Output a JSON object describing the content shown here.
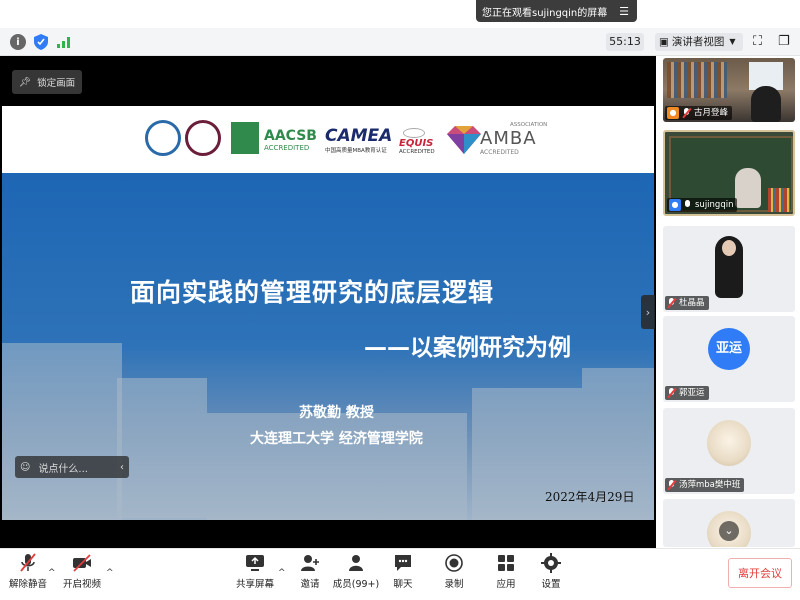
{
  "banner": {
    "text": "您正在观看sujingqin的屏幕",
    "menu_icon": "menu-icon"
  },
  "toolbar": {
    "timer": "55:13",
    "presenter_view": "演讲者视图",
    "icons": [
      "info-icon",
      "shield-icon",
      "signal-icon",
      "fullscreen-icon",
      "window-icon"
    ]
  },
  "stage": {
    "pin_label": "锁定画面",
    "chat_placeholder": "说点什么..."
  },
  "slide": {
    "logos": {
      "aacsb": "AACSB",
      "aacsb_sub": "ACCREDITED",
      "camea": "CAMEA",
      "camea_sub": "中国高质量MBA教育认证",
      "equis": "EQUIS",
      "equis_sub": "ACCREDITED",
      "amba": "AMBA",
      "amba_top": "ASSOCIATION",
      "amba_sub": "ACCREDITED"
    },
    "title": "面向实践的管理研究的底层逻辑",
    "subtitle": "——以案例研究为例",
    "speaker": "苏敬勤 教授",
    "school": "大连理工大学 经济管理学院",
    "date": "2022年4月29日"
  },
  "participants": [
    {
      "name": "古月登峰",
      "mic": "muted"
    },
    {
      "name": "sujingqin",
      "mic": "on"
    },
    {
      "name": "杜晶晶",
      "mic": "muted"
    },
    {
      "name": "郭亚运",
      "mic": "muted",
      "avatar_text": "亚运"
    },
    {
      "name": "汤萍mba樊中班",
      "mic": "muted"
    },
    {
      "name": "",
      "mic": ""
    }
  ],
  "bottombar": {
    "unmute": "解除静音",
    "start_video": "开启视频",
    "share_screen": "共享屏幕",
    "invite": "邀请",
    "members": "成员(99+)",
    "chat": "聊天",
    "record": "录制",
    "apps": "应用",
    "settings": "设置",
    "leave": "离开会议"
  },
  "colors": {
    "accent": "#2f7cf6",
    "leave": "#e23c3c",
    "slide_blue": "#1d66b4"
  }
}
